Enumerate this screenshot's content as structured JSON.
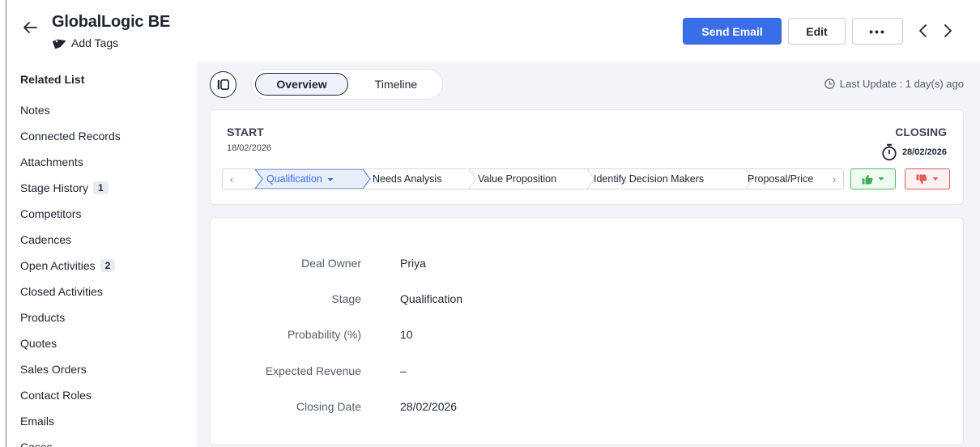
{
  "header": {
    "title": "GlobalLogic BE",
    "add_tags": "Add Tags",
    "send_email": "Send Email",
    "edit": "Edit",
    "more": "•••"
  },
  "sidebar": {
    "heading": "Related List",
    "items": [
      {
        "label": "Notes"
      },
      {
        "label": "Connected Records"
      },
      {
        "label": "Attachments"
      },
      {
        "label": "Stage History",
        "count": "1"
      },
      {
        "label": "Competitors"
      },
      {
        "label": "Cadences"
      },
      {
        "label": "Open Activities",
        "count": "2"
      },
      {
        "label": "Closed Activities"
      },
      {
        "label": "Products"
      },
      {
        "label": "Quotes"
      },
      {
        "label": "Sales Orders"
      },
      {
        "label": "Contact Roles"
      },
      {
        "label": "Emails"
      },
      {
        "label": "Cases"
      }
    ]
  },
  "tabs": {
    "overview": "Overview",
    "timeline": "Timeline"
  },
  "last_update": "Last Update : 1 day(s) ago",
  "stage": {
    "start_label": "START",
    "start_date": "18/02/2026",
    "closing_label": "CLOSING",
    "closing_date": "28/02/2026",
    "pipeline": [
      "Qualification",
      "Needs Analysis",
      "Value Proposition",
      "Identify Decision Makers",
      "Proposal/Price"
    ],
    "current": "Qualification"
  },
  "fields": [
    {
      "label": "Deal Owner",
      "value": "Priya"
    },
    {
      "label": "Stage",
      "value": "Qualification"
    },
    {
      "label": "Probability (%)",
      "value": "10"
    },
    {
      "label": "Expected Revenue",
      "value": "–"
    },
    {
      "label": "Closing Date",
      "value": "28/02/2026"
    }
  ],
  "colors": {
    "accent": "#3a6ee8",
    "won": "#3fae56",
    "lost": "#e25a5a"
  }
}
